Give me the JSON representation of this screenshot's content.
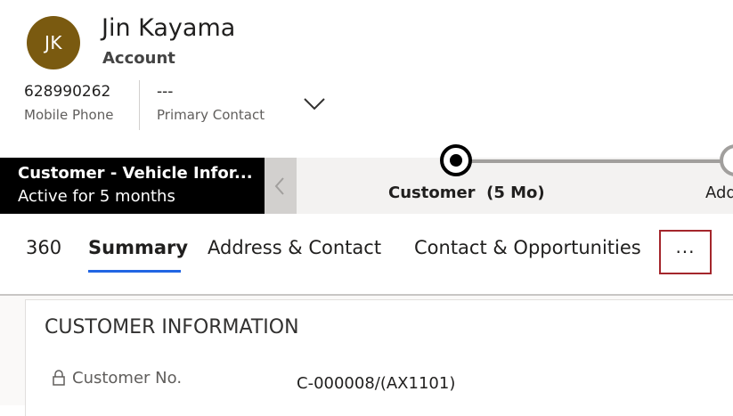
{
  "header": {
    "avatar_initials": "JK",
    "avatar_color": "#7a5a10",
    "name": "Jin Kayama",
    "entity_type": "Account",
    "fields": [
      {
        "value": "628990262",
        "label": "Mobile Phone"
      },
      {
        "value": "---",
        "label": "Primary Contact"
      }
    ],
    "expand_icon": "chevron-down-icon"
  },
  "process_bar": {
    "active_stage_title": "Customer - Vehicle Infor...",
    "active_stage_duration": "Active for 5 months",
    "prev_icon": "chevron-left-icon",
    "stages": [
      {
        "name": "Customer",
        "duration": "(5 Mo)",
        "state": "active"
      },
      {
        "name": "Add",
        "state": "next"
      }
    ]
  },
  "tabs": {
    "items": [
      {
        "label": "360",
        "selected": false
      },
      {
        "label": "Summary",
        "selected": true
      },
      {
        "label": "Address & Contact",
        "selected": false
      },
      {
        "label": "Contact & Opportunities",
        "selected": false
      }
    ],
    "more_label": "···",
    "accent_color": "#2266e3",
    "highlight_color": "#a4262c"
  },
  "form": {
    "section_title": "CUSTOMER INFORMATION",
    "fields": [
      {
        "label": "Customer No.",
        "value": "C-000008/(AX1101)",
        "locked": true,
        "lock_icon": "lock-icon"
      }
    ]
  }
}
